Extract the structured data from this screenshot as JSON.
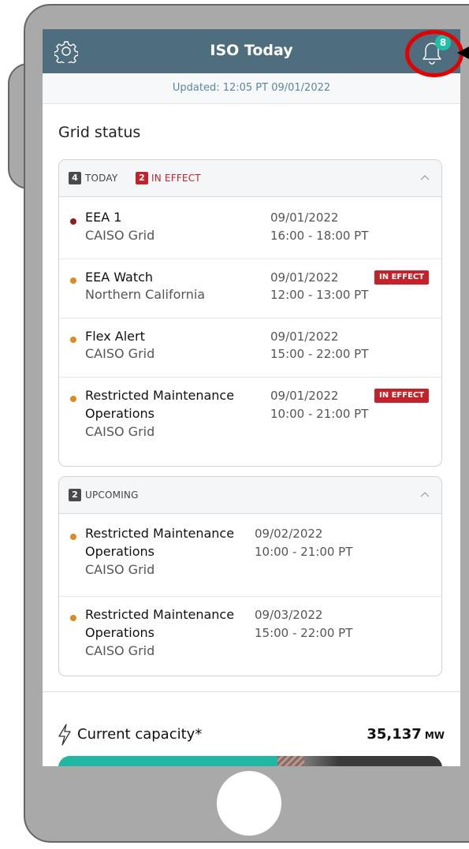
{
  "header": {
    "title": "ISO Today",
    "icon_left": "gear-icon",
    "icon_right": "bell-icon",
    "notification_count": "8",
    "accent_color": "#4e6d7e"
  },
  "updated": "Updated: 12:05 PT 09/01/2022",
  "grid_status": {
    "title": "Grid status",
    "today": {
      "count": "4",
      "label": "TODAY",
      "effect_count": "2",
      "effect_label": "IN EFFECT",
      "items": [
        {
          "name": "EEA 1",
          "region": "CAISO Grid",
          "date": "09/01/2022",
          "time": "16:00 - 18:00 PT",
          "in_effect": "",
          "dot_color": "#8a1f24"
        },
        {
          "name": "EEA Watch",
          "region": "Northern California",
          "date": "09/01/2022",
          "time": "12:00 - 13:00 PT",
          "in_effect": "IN EFFECT",
          "dot_color": "#e08a1e"
        },
        {
          "name": "Flex Alert",
          "region": "CAISO Grid",
          "date": "09/01/2022",
          "time": "15:00 - 22:00 PT",
          "in_effect": "",
          "dot_color": "#e08a1e"
        },
        {
          "name_line1": "Restricted Maintenance",
          "name_line2": "Operations",
          "region": "CAISO Grid",
          "date": "09/01/2022",
          "time": "10:00 - 21:00 PT",
          "in_effect": "IN EFFECT",
          "dot_color": "#e08a1e"
        }
      ]
    },
    "upcoming": {
      "count": "2",
      "label": "UPCOMING",
      "items": [
        {
          "name_line1": "Restricted Maintenance",
          "name_line2": "Operations",
          "region": "CAISO Grid",
          "date": "09/02/2022",
          "time": "10:00 - 21:00 PT",
          "dot_color": "#e08a1e"
        },
        {
          "name_line1": "Restricted Maintenance",
          "name_line2": "Operations",
          "region": "CAISO Grid",
          "date": "09/03/2022",
          "time": "15:00 - 22:00 PT",
          "dot_color": "#e08a1e"
        }
      ]
    }
  },
  "capacity": {
    "label": "Current capacity*",
    "value": "35,137",
    "unit": "MW",
    "icon": "lightning-icon",
    "bar_fill_fraction": 0.57,
    "bar_colors": {
      "fill": "#1fb8a4",
      "remaining": "#3a3a3a"
    }
  }
}
